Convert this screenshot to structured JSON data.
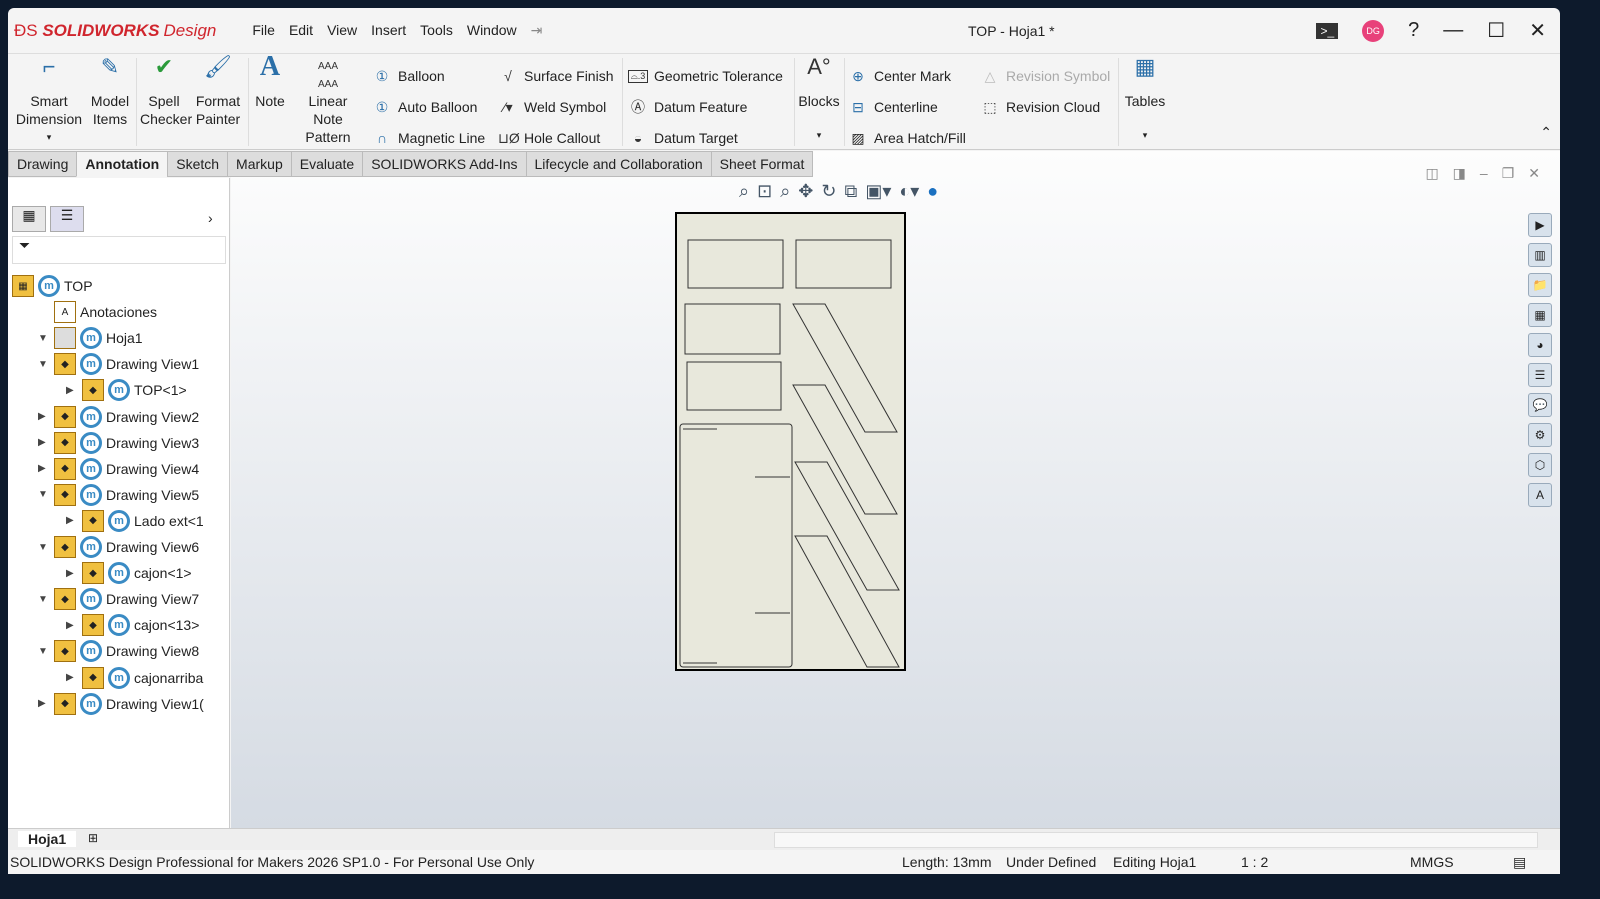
{
  "app": {
    "brand": "SOLIDWORKS",
    "brand_suffix": "Design",
    "title": "TOP - Hoja1 *",
    "avatar": "DG"
  },
  "menu": [
    "File",
    "Edit",
    "View",
    "Insert",
    "Tools",
    "Window"
  ],
  "ribbon": {
    "big": [
      {
        "label": "Smart Dimension"
      },
      {
        "label": "Model Items"
      },
      {
        "label": "Spell Checker"
      },
      {
        "label": "Format Painter"
      },
      {
        "label": "Note"
      },
      {
        "label": "Linear Note Pattern"
      },
      {
        "label": "Blocks"
      },
      {
        "label": "Tables"
      }
    ],
    "col1": [
      "Balloon",
      "Auto Balloon",
      "Magnetic Line"
    ],
    "col2": [
      "Surface Finish",
      "Weld Symbol",
      "Hole Callout"
    ],
    "col3": [
      "Geometric Tolerance",
      "Datum Feature",
      "Datum Target"
    ],
    "col4": [
      "Center Mark",
      "Centerline",
      "Area Hatch/Fill"
    ],
    "col5": [
      "Revision Symbol",
      "Revision Cloud"
    ]
  },
  "tabs": [
    "Drawing",
    "Annotation",
    "Sketch",
    "Markup",
    "Evaluate",
    "SOLIDWORKS Add-Ins",
    "Lifecycle and Collaboration",
    "Sheet Format"
  ],
  "active_tab": "Annotation",
  "tree": [
    {
      "label": "TOP",
      "level": 0,
      "icon": "part"
    },
    {
      "label": "Anotaciones",
      "level": 1,
      "icon": "annotation"
    },
    {
      "label": "Hoja1",
      "level": 1,
      "icon": "sheet",
      "exp": "▼"
    },
    {
      "label": "Drawing View1",
      "level": 2,
      "exp": "▼"
    },
    {
      "label": "TOP<1>",
      "level": 3,
      "exp": "▶"
    },
    {
      "label": "Drawing View2",
      "level": 2,
      "exp": "▶"
    },
    {
      "label": "Drawing View3",
      "level": 2,
      "exp": "▶"
    },
    {
      "label": "Drawing View4",
      "level": 2,
      "exp": "▶"
    },
    {
      "label": "Drawing View5",
      "level": 2,
      "exp": "▼"
    },
    {
      "label": "Lado ext<1",
      "level": 3,
      "exp": "▶"
    },
    {
      "label": "Drawing View6",
      "level": 2,
      "exp": "▼"
    },
    {
      "label": "cajon<1>",
      "level": 3,
      "exp": "▶"
    },
    {
      "label": "Drawing View7",
      "level": 2,
      "exp": "▼"
    },
    {
      "label": "cajon<13>",
      "level": 3,
      "exp": "▶"
    },
    {
      "label": "Drawing View8",
      "level": 2,
      "exp": "▼"
    },
    {
      "label": "cajonarriba",
      "level": 3,
      "exp": "▶"
    },
    {
      "label": "Drawing View1(",
      "level": 2,
      "exp": "▶"
    }
  ],
  "sheet_tab": "Hoja1",
  "status": {
    "product": "SOLIDWORKS Design Professional for Makers 2026 SP1.0 - For Personal Use Only",
    "length": "Length: 13mm",
    "defined": "Under Defined",
    "editing": "Editing Hoja1",
    "scale": "1 : 2",
    "units": "MMGS"
  }
}
